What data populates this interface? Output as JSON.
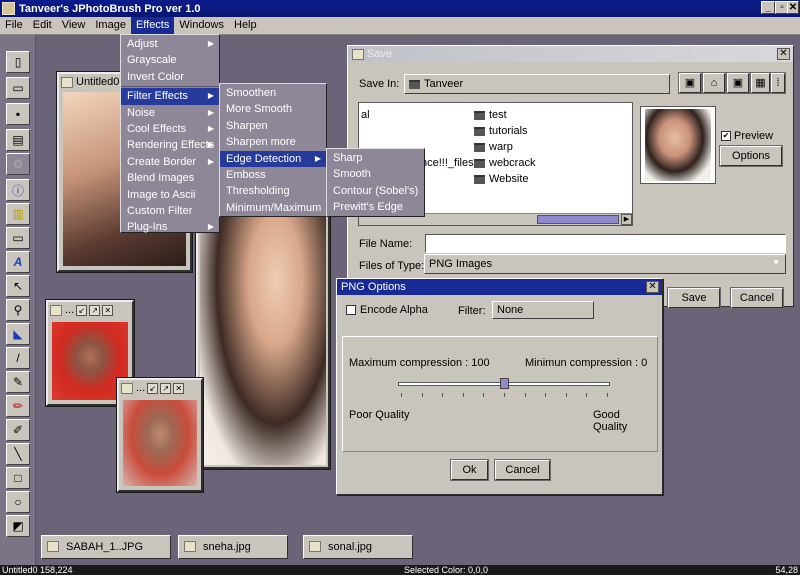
{
  "app": {
    "title": "Tanveer's  JPhotoBrush Pro ver 1.0",
    "win_min": "_",
    "win_max": "▫",
    "win_close": "✕"
  },
  "menubar": [
    "File",
    "Edit",
    "View",
    "Image",
    "Effects",
    "Windows",
    "Help"
  ],
  "effects_menu": [
    {
      "label": "Adjust",
      "sub": true
    },
    {
      "label": "Grayscale",
      "sub": false
    },
    {
      "label": "Invert Color",
      "sub": false
    },
    {
      "label": "Filter Effects",
      "sub": true
    },
    {
      "label": "Noise",
      "sub": true
    },
    {
      "label": "Cool Effects",
      "sub": true
    },
    {
      "label": "Rendering Effects",
      "sub": true
    },
    {
      "label": "Create Border",
      "sub": true
    },
    {
      "label": "Blend Images",
      "sub": false
    },
    {
      "label": "Image to Ascii",
      "sub": false
    },
    {
      "label": "Custom Filter",
      "sub": false
    },
    {
      "label": "Plug-Ins",
      "sub": true
    }
  ],
  "filter_menu": [
    {
      "label": "Smoothen",
      "sub": false
    },
    {
      "label": "More Smooth",
      "sub": false
    },
    {
      "label": "Sharpen",
      "sub": false
    },
    {
      "label": "Sharpen more",
      "sub": false
    },
    {
      "label": "Edge Detection",
      "sub": true
    },
    {
      "label": "Emboss",
      "sub": false
    },
    {
      "label": "Thresholding",
      "sub": false
    },
    {
      "label": "Minimum/Maximum",
      "sub": false
    }
  ],
  "edge_menu": [
    "Sharp",
    "Smooth",
    "Contour (Sobel's)",
    "Prewitt's Edge"
  ],
  "frames": {
    "untitled": "Untitled0",
    "small1": "...",
    "small2": "..."
  },
  "save_dialog": {
    "title": "Save",
    "save_in_label": "Save In:",
    "save_in_value": "Tanveer",
    "files_left": [
      "al",
      "",
      "",
      "nce!!!_files",
      "",
      "ds"
    ],
    "folders": [
      "test",
      "tutorials",
      "warp",
      "webcrack",
      "Website"
    ],
    "preview_label": "Preview",
    "options_label": "Options",
    "file_name_label": "File Name:",
    "file_name_value": "",
    "files_type_label": "Files of Type:",
    "files_type_value": "PNG Images",
    "save_label": "Save",
    "cancel_label": "Cancel"
  },
  "png_dialog": {
    "title": "PNG Options",
    "encode_alpha": "Encode Alpha",
    "filter_label": "Filter:",
    "filter_value": "None",
    "max_comp": "Maximum compression : 100",
    "min_comp": "Minimun compression : 0",
    "slider_value": 50,
    "poor": "Poor Quality",
    "good": "Good Quality",
    "ok": "Ok",
    "cancel": "Cancel"
  },
  "taskbar": [
    "SABAH_1..JPG",
    "sneha.jpg",
    "sonal.jpg"
  ],
  "status": {
    "left": "Untitled0  158,224",
    "center": "Selected  Color: 0,0,0",
    "right": "54,28"
  }
}
